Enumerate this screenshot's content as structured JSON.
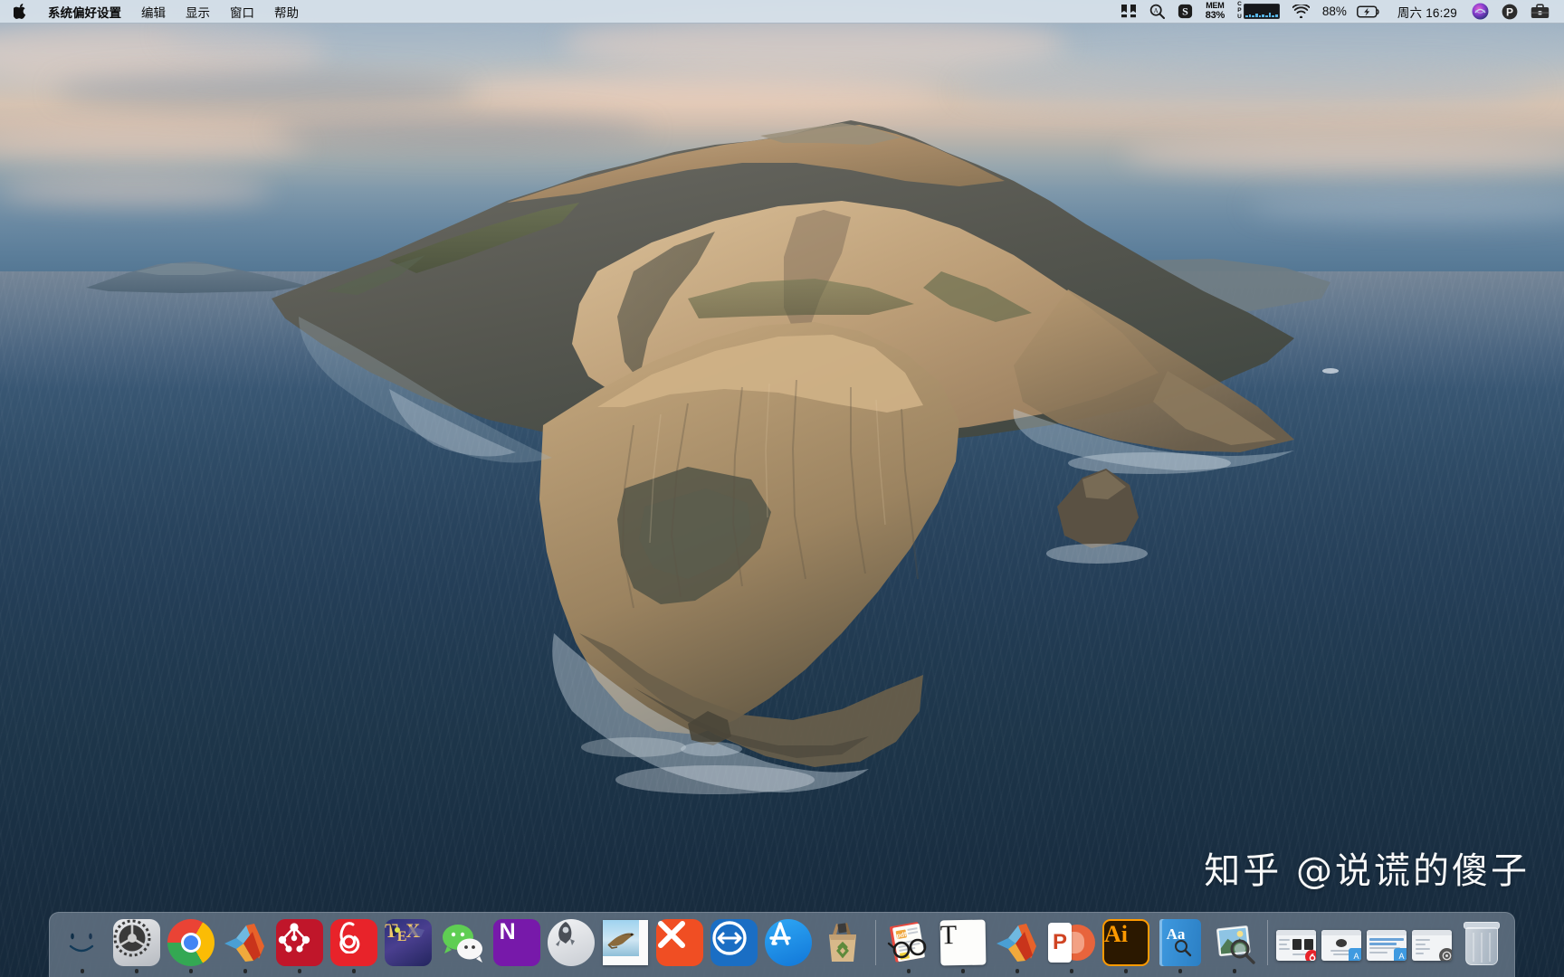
{
  "menubar": {
    "apple_icon": "apple-logo",
    "app_items": [
      {
        "label": "系统偏好设置",
        "bold": true
      },
      {
        "label": "编辑",
        "bold": false
      },
      {
        "label": "显示",
        "bold": false
      },
      {
        "label": "窗口",
        "bold": false
      },
      {
        "label": "帮助",
        "bold": false
      }
    ],
    "status": {
      "bartender_icon": "bartender-icon",
      "search_icon": "alfred-search-icon",
      "snipaste_icon": "snipaste-icon",
      "mem_label": "MEM",
      "mem_value": "83%",
      "cpu_label": "CPU",
      "wifi_icon": "wifi-icon",
      "battery_percent": "88%",
      "battery_icon": "battery-charging-icon",
      "clock": "周六 16:29",
      "siri_icon": "siri-icon",
      "p_icon": "parallels-icon",
      "control_center_icon": "control-center-icon"
    }
  },
  "watermark": {
    "text": "知乎 @说谎的傻子"
  },
  "dock": {
    "items": [
      {
        "name": "finder",
        "label": "访达",
        "running": true,
        "type": "app"
      },
      {
        "name": "system-preferences",
        "label": "系统偏好设置",
        "running": true,
        "type": "app"
      },
      {
        "name": "google-chrome",
        "label": "Google Chrome",
        "running": true,
        "type": "app"
      },
      {
        "name": "matlab",
        "label": "MATLAB",
        "running": true,
        "type": "app"
      },
      {
        "name": "mathematica",
        "label": "Mathematica",
        "running": true,
        "type": "app"
      },
      {
        "name": "netease-music",
        "label": "网易云音乐",
        "running": true,
        "type": "app"
      },
      {
        "name": "texshop",
        "label": "TeXShop",
        "running": false,
        "type": "app"
      },
      {
        "name": "wechat",
        "label": "微信",
        "running": false,
        "type": "app"
      },
      {
        "name": "onenote",
        "label": "OneNote",
        "running": false,
        "type": "app"
      },
      {
        "name": "launchpad",
        "label": "启动台",
        "running": false,
        "type": "app"
      },
      {
        "name": "mail",
        "label": "邮件",
        "running": false,
        "type": "app"
      },
      {
        "name": "xmind",
        "label": "XMind",
        "running": false,
        "type": "app"
      },
      {
        "name": "teamviewer",
        "label": "TeamViewer",
        "running": false,
        "type": "app"
      },
      {
        "name": "app-store",
        "label": "App Store",
        "running": false,
        "type": "app"
      },
      {
        "name": "trash-bag",
        "label": "废纸篓整理",
        "running": false,
        "type": "app"
      },
      {
        "name": "divider-1",
        "label": "",
        "running": false,
        "type": "separator"
      },
      {
        "name": "preview",
        "label": "预览",
        "running": true,
        "type": "app"
      },
      {
        "name": "textedit",
        "label": "文本编辑",
        "running": true,
        "type": "app"
      },
      {
        "name": "matlab-window",
        "label": "MATLAB",
        "running": true,
        "type": "app"
      },
      {
        "name": "powerpoint",
        "label": "PowerPoint",
        "running": true,
        "type": "app"
      },
      {
        "name": "illustrator",
        "label": "Illustrator",
        "running": true,
        "type": "app",
        "active": true
      },
      {
        "name": "dictionary",
        "label": "词典",
        "running": true,
        "type": "app"
      },
      {
        "name": "preview-photo",
        "label": "预览",
        "running": true,
        "type": "app"
      },
      {
        "name": "divider-2",
        "label": "",
        "running": false,
        "type": "separator"
      },
      {
        "name": "minimized-window-1",
        "label": "网易云音乐窗口",
        "running": false,
        "type": "minimized"
      },
      {
        "name": "minimized-window-2",
        "label": "文稿窗口",
        "running": false,
        "type": "minimized"
      },
      {
        "name": "minimized-window-3",
        "label": "演示文稿窗口",
        "running": false,
        "type": "minimized"
      },
      {
        "name": "minimized-window-4",
        "label": "预览窗口",
        "running": false,
        "type": "minimized"
      },
      {
        "name": "trash",
        "label": "废纸篓",
        "running": false,
        "type": "trash"
      }
    ]
  },
  "desktop": {
    "wallpaper_name": "macOS Catalina",
    "accent": "#1f86d8"
  }
}
